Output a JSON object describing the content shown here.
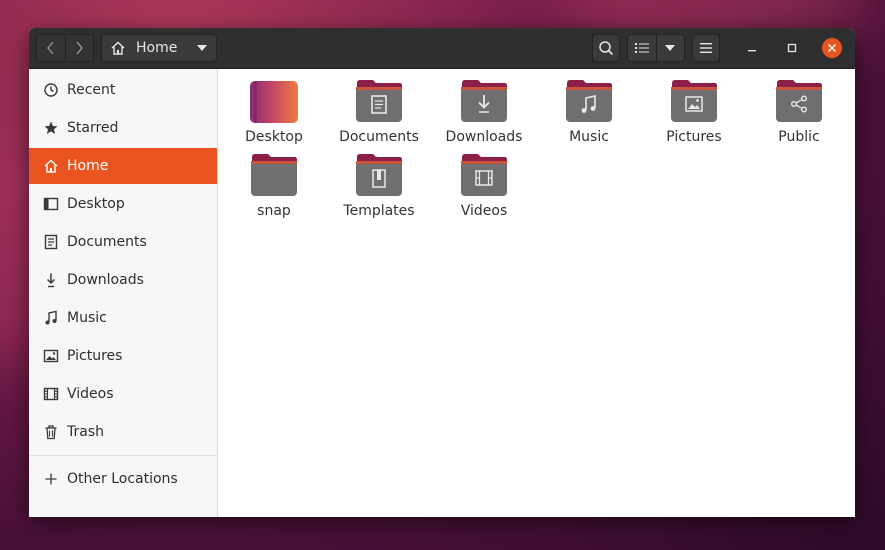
{
  "window": {
    "path_label": "Home"
  },
  "sidebar": {
    "items": [
      {
        "label": "Recent"
      },
      {
        "label": "Starred"
      },
      {
        "label": "Home"
      },
      {
        "label": "Desktop"
      },
      {
        "label": "Documents"
      },
      {
        "label": "Downloads"
      },
      {
        "label": "Music"
      },
      {
        "label": "Pictures"
      },
      {
        "label": "Videos"
      },
      {
        "label": "Trash"
      }
    ],
    "other_locations": "Other Locations"
  },
  "files": [
    {
      "name": "Desktop",
      "icon": "desktop-folder-icon"
    },
    {
      "name": "Documents",
      "icon": "documents-folder-icon"
    },
    {
      "name": "Downloads",
      "icon": "downloads-folder-icon"
    },
    {
      "name": "Music",
      "icon": "music-folder-icon"
    },
    {
      "name": "Pictures",
      "icon": "pictures-folder-icon"
    },
    {
      "name": "Public",
      "icon": "public-folder-icon"
    },
    {
      "name": "snap",
      "icon": "folder-icon"
    },
    {
      "name": "Templates",
      "icon": "templates-folder-icon"
    },
    {
      "name": "Videos",
      "icon": "videos-folder-icon"
    }
  ],
  "colors": {
    "accent": "#e95420",
    "folder_body": "#6f6f6f",
    "folder_tab": "#8c1f45",
    "headerbar": "#2f2f2f"
  }
}
